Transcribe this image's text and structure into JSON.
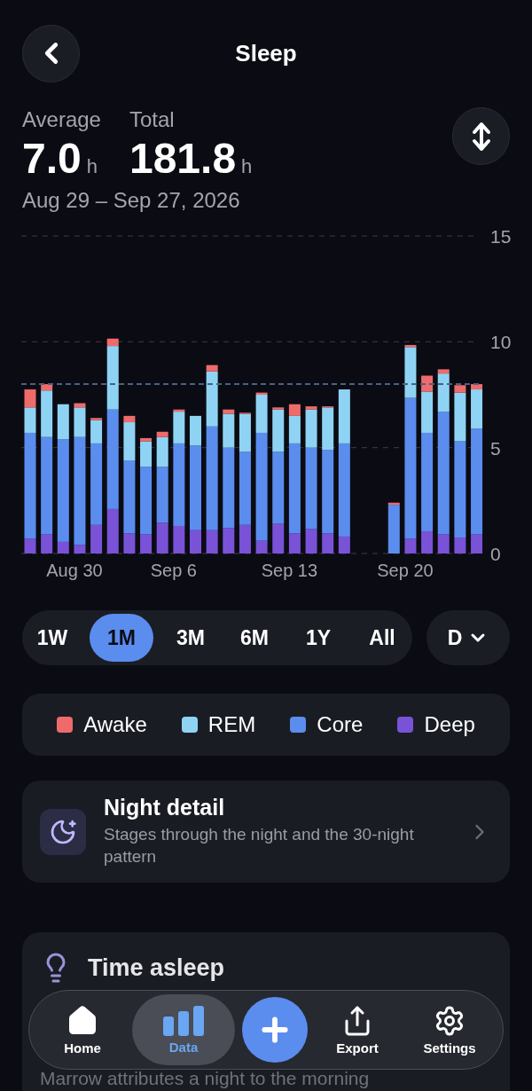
{
  "header": {
    "title": "Sleep"
  },
  "stats": [
    {
      "label": "Average",
      "value": "7.0",
      "unit": "h"
    },
    {
      "label": "Total",
      "value": "181.8",
      "unit": "h"
    }
  ],
  "date_range": "Aug 29 – Sep 27, 2026",
  "chart_data": {
    "type": "bar",
    "stacked": true,
    "categories": [
      null,
      null,
      null,
      "Aug 30",
      null,
      null,
      null,
      null,
      null,
      "Sep 6",
      null,
      null,
      null,
      null,
      null,
      null,
      "Sep 13",
      null,
      null,
      null,
      null,
      null,
      null,
      "Sep 20",
      null,
      null,
      null,
      null
    ],
    "ylim": [
      0,
      15
    ],
    "yticks": [
      0,
      5,
      10,
      15
    ],
    "series": [
      {
        "name": "Deep",
        "color": "#7a52d8",
        "values": [
          0.7,
          0.9,
          0.55,
          0.4,
          1.35,
          2.1,
          0.95,
          0.9,
          1.45,
          1.3,
          1.1,
          1.1,
          1.2,
          1.35,
          0.6,
          1.4,
          0.95,
          1.15,
          0.95,
          0.8,
          null,
          null,
          0,
          0.7,
          1.05,
          0.9,
          0.75,
          0.9
        ]
      },
      {
        "name": "Core",
        "color": "#5b8def",
        "values": [
          5.0,
          4.6,
          4.85,
          5.1,
          3.85,
          4.7,
          3.45,
          3.2,
          2.65,
          3.9,
          4.0,
          4.9,
          3.8,
          3.45,
          5.1,
          3.4,
          4.25,
          3.85,
          3.95,
          4.4,
          null,
          null,
          2.3,
          6.65,
          4.65,
          5.8,
          4.55,
          5.0
        ]
      },
      {
        "name": "REM",
        "color": "#8fd3f4",
        "values": [
          1.2,
          2.2,
          1.65,
          1.4,
          1.1,
          3.0,
          1.8,
          1.2,
          1.4,
          1.5,
          1.4,
          2.6,
          1.6,
          1.8,
          1.8,
          2.0,
          1.3,
          1.8,
          2.0,
          2.55,
          null,
          null,
          0,
          2.4,
          1.95,
          1.8,
          2.3,
          1.85
        ]
      },
      {
        "name": "Awake",
        "color": "#ef6b6b",
        "values": [
          0.85,
          0.3,
          0,
          0.2,
          0.1,
          0.35,
          0.3,
          0.15,
          0.25,
          0.1,
          0,
          0.3,
          0.2,
          0.05,
          0.1,
          0.1,
          0.55,
          0.15,
          0.05,
          0,
          null,
          null,
          0.1,
          0.1,
          0.75,
          0.2,
          0.35,
          0.25
        ]
      }
    ]
  },
  "ranges": [
    {
      "label": "1W",
      "selected": false
    },
    {
      "label": "1M",
      "selected": true
    },
    {
      "label": "3M",
      "selected": false
    },
    {
      "label": "6M",
      "selected": false
    },
    {
      "label": "1Y",
      "selected": false
    },
    {
      "label": "All",
      "selected": false
    }
  ],
  "granularity": {
    "label": "D"
  },
  "night_detail": {
    "title": "Night detail",
    "subtitle": "Stages through the night and the 30-night pattern"
  },
  "time_asleep": {
    "title": "Time asleep",
    "text": "Marrow attributes a night to the morning"
  },
  "nav": [
    {
      "kind": "home",
      "label": "Home",
      "selected": false
    },
    {
      "kind": "data",
      "label": "Data",
      "selected": true
    },
    {
      "kind": "add"
    },
    {
      "kind": "export",
      "label": "Export",
      "selected": false
    },
    {
      "kind": "settings",
      "label": "Settings",
      "selected": false
    }
  ]
}
